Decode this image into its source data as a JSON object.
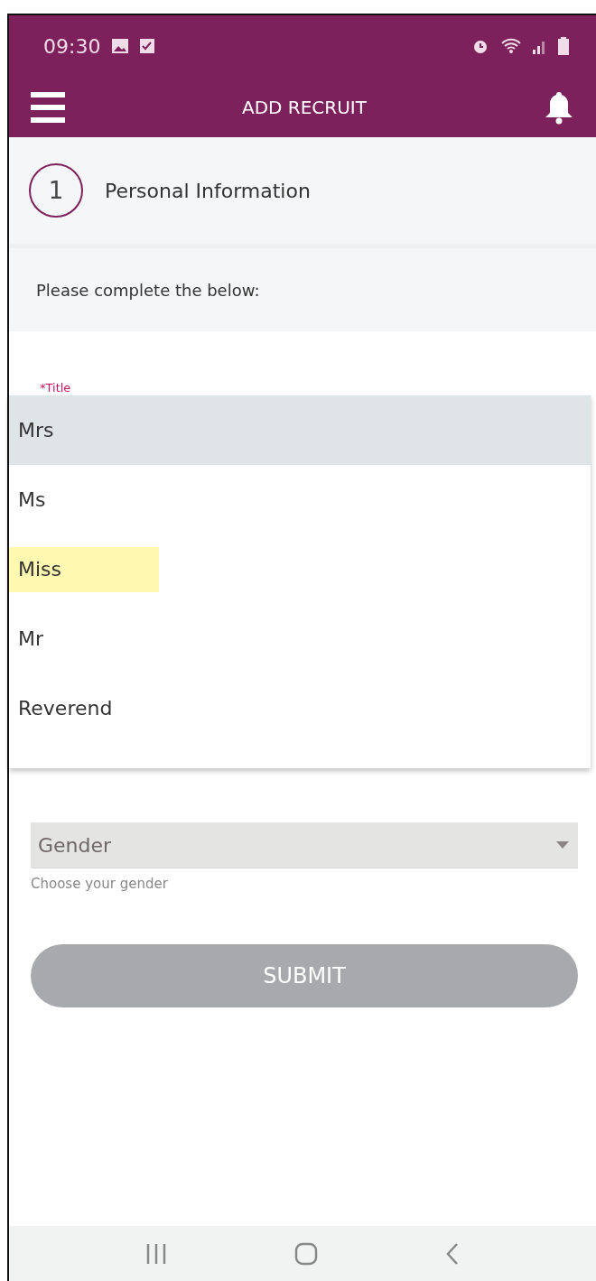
{
  "status_bar": {
    "time": "09:30"
  },
  "app_bar": {
    "title": "ADD RECRUIT"
  },
  "step": {
    "number": "1",
    "title": "Personal Information"
  },
  "instruction": "Please complete the below:",
  "title_field": {
    "label": "*Title"
  },
  "title_menu": [
    {
      "label": "Mrs",
      "focused": true,
      "highlighted": false
    },
    {
      "label": "Ms",
      "focused": false,
      "highlighted": false
    },
    {
      "label": "Miss",
      "focused": false,
      "highlighted": true
    },
    {
      "label": "Mr",
      "focused": false,
      "highlighted": false
    },
    {
      "label": "Reverend",
      "focused": false,
      "highlighted": false
    }
  ],
  "gender_field": {
    "placeholder": "Gender",
    "helper": "Choose your gender"
  },
  "submit_button": {
    "label": "SUBMIT",
    "disabled": true
  }
}
